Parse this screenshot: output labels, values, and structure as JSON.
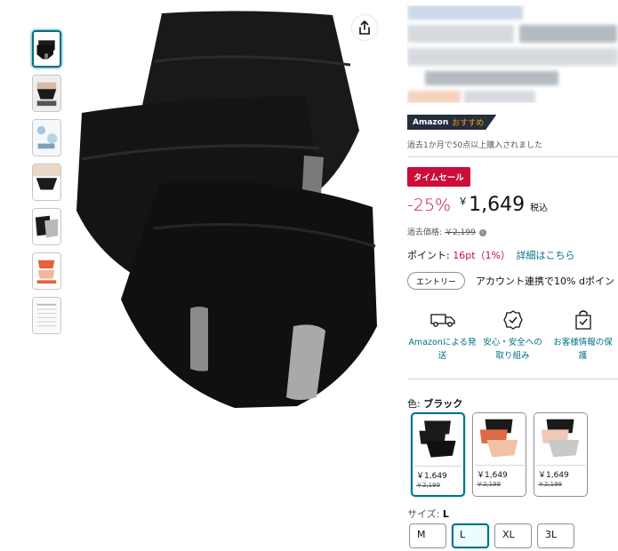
{
  "gallery": {
    "thumbnails": [
      {
        "name": "thumb-black-3pack",
        "selected": true
      },
      {
        "name": "thumb-model",
        "selected": false
      },
      {
        "name": "thumb-detail",
        "selected": false
      },
      {
        "name": "thumb-worn",
        "selected": false
      },
      {
        "name": "thumb-gray-layer",
        "selected": false
      },
      {
        "name": "thumb-orange-pack",
        "selected": false
      },
      {
        "name": "thumb-size-chart",
        "selected": false
      }
    ],
    "share_icon": "share-icon"
  },
  "product": {
    "badge_brand": "Amazon",
    "badge_choice": "おすすめ",
    "bought_text": "過去1か月で50点以上購入されました",
    "sale_badge": "タイムセール",
    "discount": "-25%",
    "currency": "￥",
    "price": "1,649",
    "tax_label": "税込",
    "past_price_label": "過去価格:",
    "past_price": "￥2,199",
    "points_label": "ポイント:",
    "points_value": "16pt（1%）",
    "points_link": "詳細はこちら",
    "entry_button": "エントリー",
    "entry_text": "アカウント連携で10% dポイン"
  },
  "features": [
    {
      "icon": "delivery-truck-icon",
      "line1": "Amazonによる発",
      "line2": "送"
    },
    {
      "icon": "safety-badge-icon",
      "line1": "安心・安全への",
      "line2": "取り組み"
    },
    {
      "icon": "privacy-bag-icon",
      "line1": "お客様情報の保",
      "line2": "護"
    }
  ],
  "variants": {
    "color_label": "色:",
    "color_selected": "ブラック",
    "swatches": [
      {
        "name": "swatch-black",
        "price": "￥1,649",
        "old_price": "￥2,199",
        "selected": true,
        "colors": [
          "#1a1a1a",
          "#1a1a1a",
          "#1a1a1a"
        ]
      },
      {
        "name": "swatch-orange-mix",
        "price": "￥1,649",
        "old_price": "￥2,199",
        "selected": false,
        "colors": [
          "#1a1a1a",
          "#e06a46",
          "#f2c2a6"
        ]
      },
      {
        "name": "swatch-beige-mix",
        "price": "￥1,649",
        "old_price": "￥2,199",
        "selected": false,
        "colors": [
          "#1a1a1a",
          "#f0c9b8",
          "#c9c9c9"
        ]
      }
    ],
    "size_label": "サイズ:",
    "size_selected": "L",
    "sizes": [
      {
        "label": "M",
        "selected": false
      },
      {
        "label": "L",
        "selected": true
      },
      {
        "label": "XL",
        "selected": false
      },
      {
        "label": "3L",
        "selected": false
      }
    ]
  },
  "colors": {
    "link": "#007185",
    "sale_red": "#cc0c39",
    "badge_dark": "#232f3e",
    "badge_orange": "#ff9900"
  }
}
